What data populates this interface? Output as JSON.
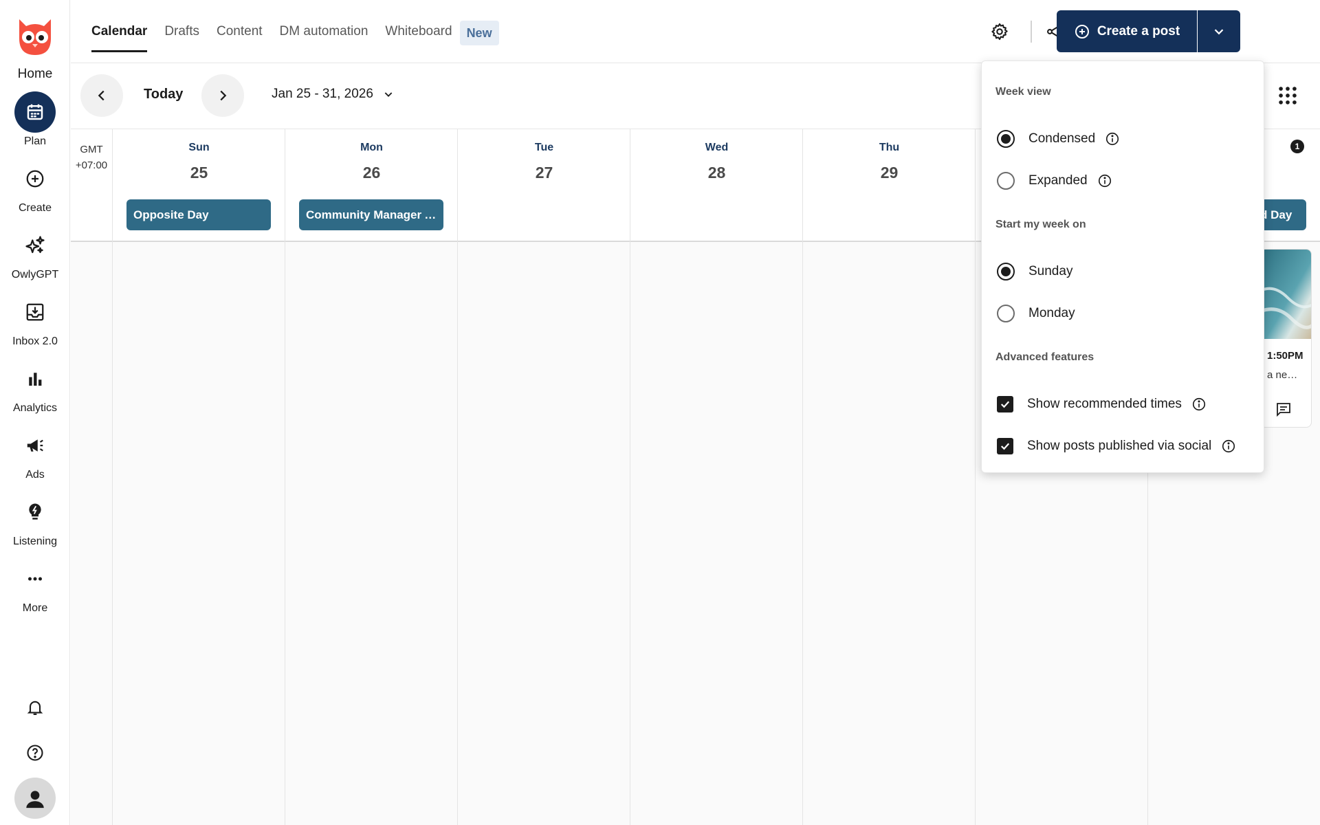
{
  "sidebar": {
    "home_label": "Home",
    "items": [
      {
        "label": "Plan",
        "icon": "calendar-icon"
      },
      {
        "label": "Create",
        "icon": "plus-circle-icon"
      },
      {
        "label": "OwlyGPT",
        "icon": "sparkle-icon"
      },
      {
        "label": "Inbox 2.0",
        "icon": "inbox-icon"
      },
      {
        "label": "Analytics",
        "icon": "bar-chart-icon"
      },
      {
        "label": "Ads",
        "icon": "megaphone-icon"
      },
      {
        "label": "Listening",
        "icon": "lightbulb-icon"
      },
      {
        "label": "More",
        "icon": "more-dots-icon"
      }
    ]
  },
  "header": {
    "tabs": [
      "Calendar",
      "Drafts",
      "Content",
      "DM automation",
      "Whiteboard"
    ],
    "new_badge": "New",
    "create_label": "Create a post"
  },
  "toolbar": {
    "today_label": "Today",
    "date_range": "Jan 25 - 31, 2026"
  },
  "calendar": {
    "timezone_line1": "GMT",
    "timezone_line2": "+07:00",
    "days": [
      {
        "name": "Sun",
        "num": "25"
      },
      {
        "name": "Mon",
        "num": "26"
      },
      {
        "name": "Tue",
        "num": "27"
      },
      {
        "name": "Wed",
        "num": "28"
      },
      {
        "name": "Thu",
        "num": "29"
      }
    ],
    "events": [
      {
        "label": "Opposite Day"
      },
      {
        "label": "Community Manager Appreciation Day"
      },
      {
        "label": "d Day"
      }
    ],
    "sat_badge_count": "1",
    "post": {
      "time": "1:50PM",
      "snippet": "a ne…"
    }
  },
  "settings_panel": {
    "week_view_heading": "Week view",
    "condensed_label": "Condensed",
    "expanded_label": "Expanded",
    "start_week_heading": "Start my week on",
    "sunday_label": "Sunday",
    "monday_label": "Monday",
    "advanced_heading": "Advanced features",
    "recommended_label": "Show recommended times",
    "published_label": "Show posts published via social"
  },
  "colors": {
    "brand_navy": "#143059",
    "event_teal": "#2f6a86",
    "logo_red": "#f4503f"
  }
}
